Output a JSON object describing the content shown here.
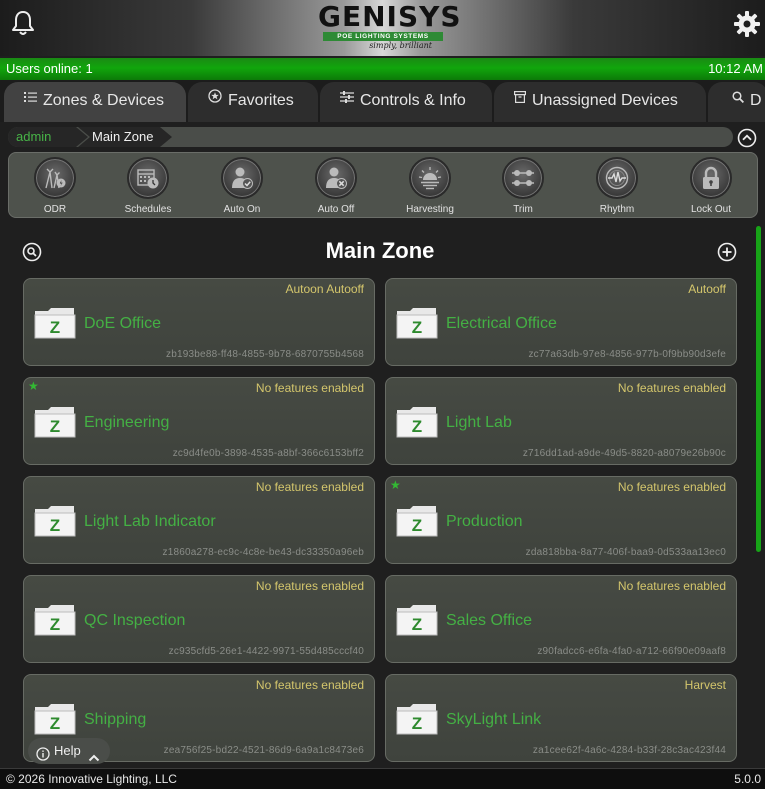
{
  "header": {
    "logo_text": "GENISYS",
    "logo_strip": "POE LIGHTING SYSTEMS",
    "logo_tagline": "simply, brilliant"
  },
  "status": {
    "users_online": "Users online: 1",
    "time": "10:12 AM"
  },
  "tabs": [
    {
      "label": "Zones & Devices",
      "icon": "list-icon",
      "active": true
    },
    {
      "label": "Favorites",
      "icon": "star-circle-icon"
    },
    {
      "label": "Controls & Info",
      "icon": "sliders-icon"
    },
    {
      "label": "Unassigned Devices",
      "icon": "box-icon"
    },
    {
      "label": "D",
      "icon": "search-icon"
    }
  ],
  "breadcrumb": {
    "root": "admin",
    "current": "Main Zone"
  },
  "toolbar": [
    {
      "label": "ODR",
      "icon": "odr-icon"
    },
    {
      "label": "Schedules",
      "icon": "calendar-clock-icon"
    },
    {
      "label": "Auto On",
      "icon": "person-check-icon"
    },
    {
      "label": "Auto Off",
      "icon": "person-x-icon"
    },
    {
      "label": "Harvesting",
      "icon": "sunrise-icon"
    },
    {
      "label": "Trim",
      "icon": "trim-icon"
    },
    {
      "label": "Rhythm",
      "icon": "rhythm-icon"
    },
    {
      "label": "Lock Out",
      "icon": "lock-icon"
    }
  ],
  "zone_title": "Main Zone",
  "zones": [
    {
      "name": "DoE Office",
      "features": "Autoon Autooff",
      "id": "zb193be88-ff48-4855-9b78-6870755b4568",
      "favorite": false
    },
    {
      "name": "Electrical Office",
      "features": "Autooff",
      "id": "zc77a63db-97e8-4856-977b-0f9bb90d3efe",
      "favorite": false
    },
    {
      "name": "Engineering",
      "features": "No features enabled",
      "id": "zc9d4fe0b-3898-4535-a8bf-366c6153bff2",
      "favorite": true
    },
    {
      "name": "Light Lab",
      "features": "No features enabled",
      "id": "z716dd1ad-a9de-49d5-8820-a8079e26b90c",
      "favorite": false
    },
    {
      "name": "Light Lab Indicator",
      "features": "No features enabled",
      "id": "z1860a278-ec9c-4c8e-be43-dc33350a96eb",
      "favorite": false
    },
    {
      "name": "Production",
      "features": "No features enabled",
      "id": "zda818bba-8a77-406f-baa9-0d533aa13ec0",
      "favorite": true
    },
    {
      "name": "QC Inspection",
      "features": "No features enabled",
      "id": "zc935cfd5-26e1-4422-9971-55d485cccf40",
      "favorite": false
    },
    {
      "name": "Sales Office",
      "features": "No features enabled",
      "id": "z90fadcc6-e6fa-4fa0-a712-66f90e09aaf8",
      "favorite": false
    },
    {
      "name": "Shipping",
      "features": "No features enabled",
      "id": "zea756f25-bd22-4521-86d9-6a9a1c8473e6",
      "favorite": false
    },
    {
      "name": "SkyLight Link",
      "features": "Harvest",
      "id": "za1cee62f-4a6c-4284-b33f-28c3ac423f44",
      "favorite": false
    }
  ],
  "folder_letter": "Z",
  "favorite_star": "★",
  "help": {
    "label": "Help"
  },
  "footer": {
    "copyright": "© 2026 Innovative Lighting, LLC",
    "version": "5.0.0"
  },
  "colors": {
    "accent_green": "#11a60c",
    "zone_name": "#44b044",
    "features_text": "#d4c66c"
  }
}
